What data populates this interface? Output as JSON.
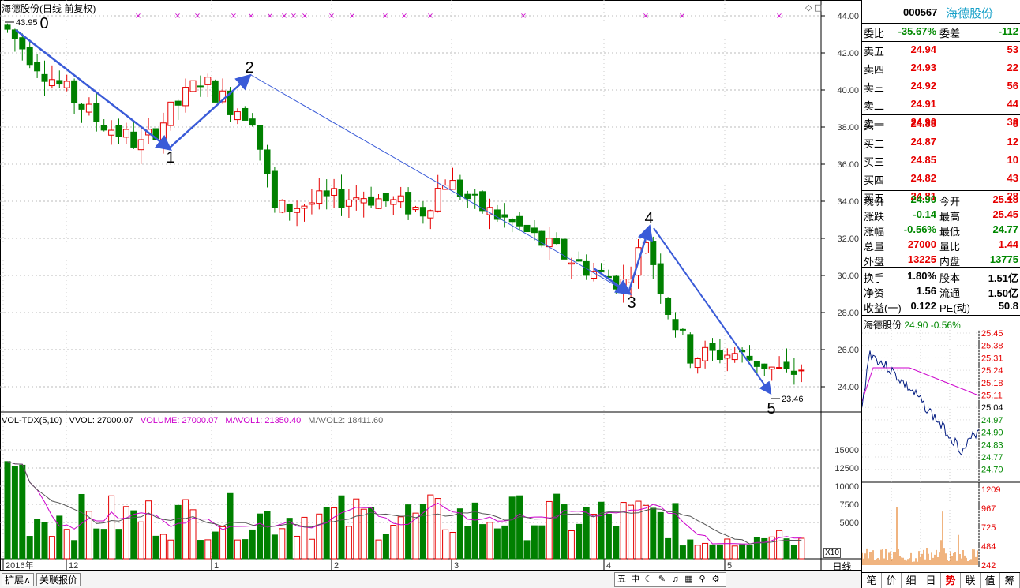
{
  "chart": {
    "title": "海德股份(日线 前复权)",
    "high_marker": "43.95",
    "low_marker": "23.46",
    "price_axis_ticks": [
      "44.00",
      "42.00",
      "40.00",
      "38.00",
      "36.00",
      "34.00",
      "32.00",
      "30.00",
      "28.00",
      "26.00",
      "24.00"
    ],
    "volume_axis_ticks": [
      "15000",
      "12500",
      "10000",
      "7500",
      "5000"
    ],
    "x10_label": "X10",
    "date_labels": [
      "2016年",
      "12",
      "1",
      "2",
      "3",
      "4",
      "5"
    ],
    "wave_labels": [
      "0",
      "1",
      "2",
      "3",
      "4",
      "5"
    ],
    "period_label": "日线",
    "colors": {
      "up": "#e60000",
      "down": "#008000",
      "arrow": "#3a5bd8",
      "ma1": "#cc00cc",
      "ma2": "#555555"
    }
  },
  "volume_indicator": {
    "name": "VOL-TDX(5,10)",
    "vvol": "VVOL: 27000.07",
    "volume": "VOLUME: 27000.07",
    "mavol1": "MAVOL1: 21350.40",
    "mavol2": "MAVOL2: 18411.60"
  },
  "quote": {
    "code": "000567",
    "name": "海德股份",
    "weibi_label": "委比",
    "weibi_value": "-35.67%",
    "weicha_label": "委差",
    "weicha_value": "-112",
    "sell": [
      {
        "label": "卖五",
        "price": "24.94",
        "vol": "53"
      },
      {
        "label": "卖四",
        "price": "24.93",
        "vol": "22"
      },
      {
        "label": "卖三",
        "price": "24.92",
        "vol": "56"
      },
      {
        "label": "卖二",
        "price": "24.91",
        "vol": "44"
      },
      {
        "label": "卖一",
        "price": "24.90",
        "vol": "38"
      }
    ],
    "buy": [
      {
        "label": "买一",
        "price": "24.88",
        "vol": "8"
      },
      {
        "label": "买二",
        "price": "24.87",
        "vol": "12"
      },
      {
        "label": "买三",
        "price": "24.85",
        "vol": "10"
      },
      {
        "label": "买四",
        "price": "24.82",
        "vol": "43"
      },
      {
        "label": "买五",
        "price": "24.81",
        "vol": "28"
      }
    ],
    "stats": [
      {
        "l1": "现价",
        "v1": "24.90",
        "l2": "今开",
        "v2": "25.18"
      },
      {
        "l1": "涨跌",
        "v1": "-0.14",
        "l2": "最高",
        "v2": "25.45"
      },
      {
        "l1": "涨幅",
        "v1": "-0.56%",
        "l2": "最低",
        "v2": "24.77"
      },
      {
        "l1": "总量",
        "v1": "27000",
        "l2": "量比",
        "v2": "1.44"
      },
      {
        "l1": "外盘",
        "v1": "13225",
        "l2": "内盘",
        "v2": "13775"
      }
    ],
    "fund": [
      {
        "l1": "换手",
        "v1": "1.80%",
        "l2": "股本",
        "v2": "1.51亿"
      },
      {
        "l1": "净资",
        "v1": "1.56",
        "l2": "流通",
        "v2": "1.50亿"
      },
      {
        "l1": "收益(一)",
        "v1": "0.122",
        "l2": "PE(动)",
        "v2": "50.8"
      }
    ]
  },
  "intraday": {
    "name": "海德股份",
    "price": "24.90",
    "change": "-0.56%",
    "right_ticks": [
      "25.45",
      "25.38",
      "25.31",
      "25.24",
      "25.18",
      "25.11",
      "25.04",
      "24.97",
      "24.90",
      "24.83",
      "24.77",
      "24.70"
    ],
    "vol_ticks": [
      "1209",
      "967",
      "725",
      "484",
      "242"
    ]
  },
  "tabs": [
    "笔",
    "价",
    "细",
    "日",
    "势",
    "联",
    "值",
    "筹"
  ],
  "active_tab": "势",
  "bottom": {
    "expand_button": "扩展∧",
    "related_button": "关联报价"
  },
  "toolbar": [
    "五",
    "中",
    "☾",
    "✎",
    "♫",
    "▦",
    "⚲",
    "⚙"
  ]
}
